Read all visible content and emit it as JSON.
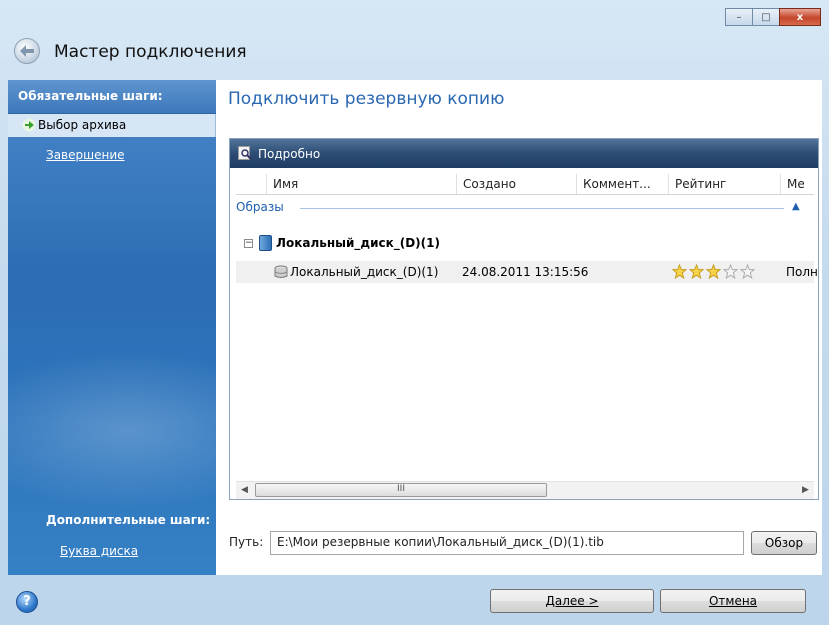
{
  "window": {
    "title": "Мастер подключения",
    "controls": {
      "minimize": "–",
      "maximize": "□",
      "close": "x"
    }
  },
  "sidebar": {
    "required_header": "Обязательные шаги:",
    "steps": [
      {
        "label": "Выбор архива",
        "selected": true
      },
      {
        "label": "Завершение",
        "selected": false
      }
    ],
    "optional_header": "Дополнительные шаги:",
    "optional_steps": [
      {
        "label": "Буква диска"
      }
    ]
  },
  "main": {
    "title": "Подключить резервную копию",
    "panel_title": "Подробно",
    "columns": [
      "Имя",
      "Создано",
      "Коммент...",
      "Рейтинг",
      "Ме"
    ],
    "group_label": "Образы",
    "node_label": "Локальный_диск_(D)(1)",
    "row": {
      "name": "Локальный_диск_(D)(1)",
      "created": "24.08.2011 13:15:56",
      "rating_filled": 3,
      "rating_total": 5,
      "method": "Полн"
    },
    "scroll_thumb": "III",
    "path_label": "Путь:",
    "path_value": "E:\\Мои резервные копии\\Локальный_диск_(D)(1).tib",
    "browse_label": "Обзор"
  },
  "footer": {
    "help": "?",
    "next_label": "Далее >",
    "cancel_label": "Отмена"
  },
  "colors": {
    "accent": "#2a67b1",
    "sidebar": "#2b6db5",
    "panel_header": "#2c4c74"
  }
}
